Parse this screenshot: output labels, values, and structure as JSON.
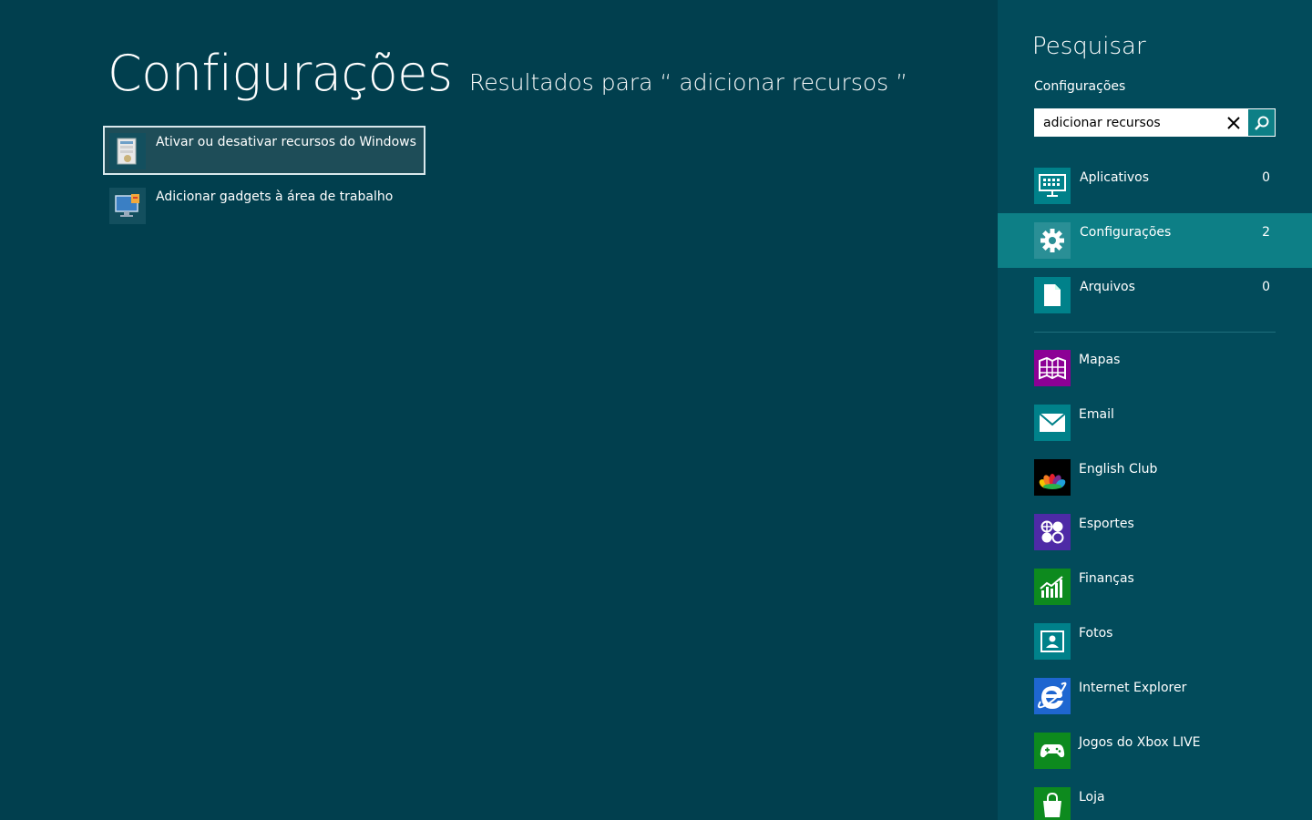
{
  "main": {
    "title": "Configurações",
    "results_heading": "Resultados para “ adicionar recursos ”",
    "results": [
      {
        "label": "Ativar ou desativar recursos do Windows",
        "icon": "windows-features-icon",
        "selected": true
      },
      {
        "label": "Adicionar gadgets à área de trabalho",
        "icon": "desktop-gadgets-icon",
        "selected": false
      }
    ]
  },
  "charm": {
    "title": "Pesquisar",
    "scope_label": "Configurações",
    "search_value": "adicionar recursos",
    "clear_icon": "close-icon",
    "search_icon": "search-icon",
    "scopes": [
      {
        "label": "Aplicativos",
        "count": "0",
        "icon": "apps-icon",
        "active": false
      },
      {
        "label": "Configurações",
        "count": "2",
        "icon": "gear-icon",
        "active": true
      },
      {
        "label": "Arquivos",
        "count": "0",
        "icon": "file-icon",
        "active": false
      }
    ],
    "apps": [
      {
        "label": "Mapas",
        "icon": "map-icon",
        "color": "#8c0095"
      },
      {
        "label": "Email",
        "icon": "mail-icon",
        "color": "#00818a"
      },
      {
        "label": "English Club",
        "icon": "peacock-icon",
        "color": "#000000"
      },
      {
        "label": "Esportes",
        "icon": "sports-icon",
        "color": "#4e2aa6"
      },
      {
        "label": "Finanças",
        "icon": "finance-chart-icon",
        "color": "#0d8a1e"
      },
      {
        "label": "Fotos",
        "icon": "photo-icon",
        "color": "#00818a"
      },
      {
        "label": "Internet Explorer",
        "icon": "internet-explorer-icon",
        "color": "#1e66d0"
      },
      {
        "label": "Jogos do Xbox LIVE",
        "icon": "game-controller-icon",
        "color": "#0d8a1e"
      },
      {
        "label": "Loja",
        "icon": "store-bag-icon",
        "color": "#0d8a1e"
      }
    ]
  }
}
